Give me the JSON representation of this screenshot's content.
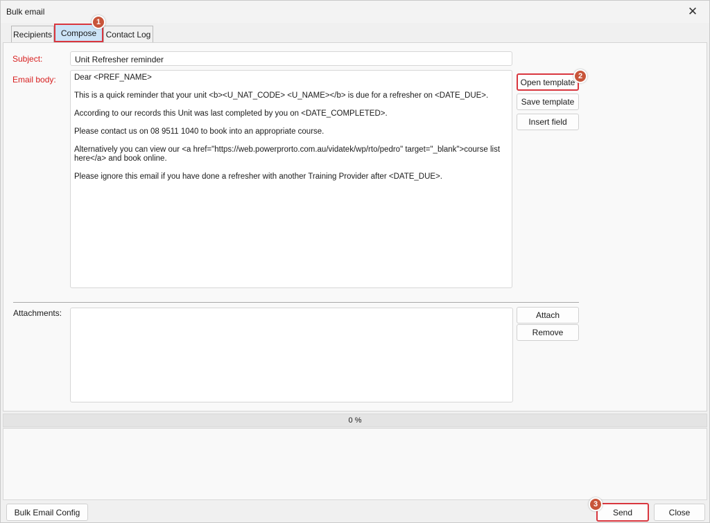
{
  "window": {
    "title": "Bulk email",
    "close_glyph": "✕"
  },
  "tabs": [
    {
      "label": "Recipients",
      "active": false
    },
    {
      "label": "Compose",
      "active": true
    },
    {
      "label": "Contact Log",
      "active": false
    }
  ],
  "compose": {
    "subject_label": "Subject:",
    "subject_value": "Unit Refresher reminder",
    "body_label": "Email body:",
    "body_paragraphs": [
      "Dear <PREF_NAME>",
      "This is a quick reminder that your unit <b><U_NAT_CODE> <U_NAME></b> is due for a refresher on <DATE_DUE>.",
      "According to our records this Unit was last completed by you on <DATE_COMPLETED>.",
      "Please contact us on 08 9511 1040 to book into an appropriate course.",
      "Alternatively you can view our <a href=\"https://web.powerprorto.com.au/vidatek/wp/rto/pedro\" target=\"_blank\">course list\nhere</a> and book online.",
      "Please ignore this email if you have done a refresher with another Training Provider after <DATE_DUE>."
    ],
    "open_template_label": "Open template",
    "save_template_label": "Save template",
    "insert_field_label": "Insert field",
    "attachments_label": "Attachments:",
    "attach_label": "Attach",
    "remove_label": "Remove"
  },
  "progress": {
    "text": "0 %",
    "value": 0
  },
  "footer": {
    "config_label": "Bulk Email Config",
    "send_label": "Send",
    "close_label": "Close"
  },
  "badges": [
    "1",
    "2",
    "3"
  ],
  "colors": {
    "highlight": "#d9363e",
    "label_red": "#d71e1e",
    "badge": "#c8553a",
    "active_tab": "#cce4f7"
  }
}
